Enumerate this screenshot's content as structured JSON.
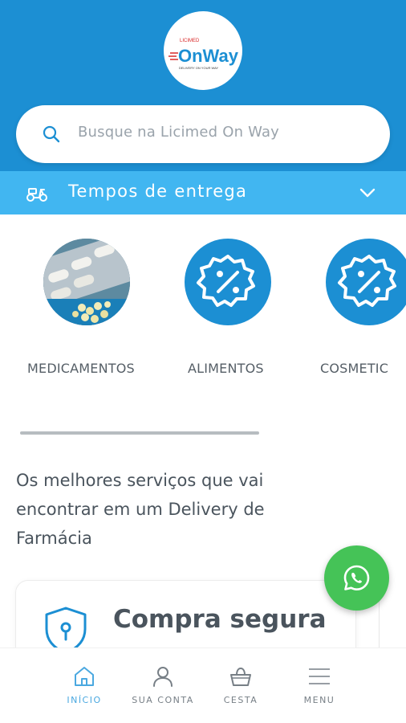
{
  "header": {
    "logo": {
      "brand_small": "LICIMED",
      "brand_main": "OnWay",
      "tagline": "DELIVERY ON YOUR WAY",
      "icon": "onway-logo"
    },
    "background_color": "#1c8fd3"
  },
  "search": {
    "placeholder": "Busque na Licimed On Way",
    "icon": "search-icon"
  },
  "delivery": {
    "label": "Tempos de entrega",
    "icon": "scooter-icon",
    "chevron": "chevron-down-icon",
    "background_color": "#41b6f1"
  },
  "categories": [
    {
      "label": "MEDICAMENTOS",
      "icon": "pills-photo"
    },
    {
      "label": "ALIMENTOS",
      "icon": "discount-badge-icon"
    },
    {
      "label": "COSMETIC",
      "icon": "discount-badge-icon"
    }
  ],
  "services": {
    "text": "Os melhores serviços que vai encontrar em um Delivery de Farmácia"
  },
  "feature_card": {
    "title": "Compra segura",
    "icon": "shield-lock-icon"
  },
  "whatsapp": {
    "icon": "whatsapp-icon",
    "color": "#45c357"
  },
  "bottom_nav": {
    "items": [
      {
        "label": "INÍCIO",
        "icon": "home-icon",
        "active": true
      },
      {
        "label": "SUA CONTA",
        "icon": "user-icon",
        "active": false
      },
      {
        "label": "CESTA",
        "icon": "basket-icon",
        "active": false
      },
      {
        "label": "MENU",
        "icon": "menu-icon",
        "active": false
      }
    ],
    "active_color": "#4aa8e0"
  }
}
